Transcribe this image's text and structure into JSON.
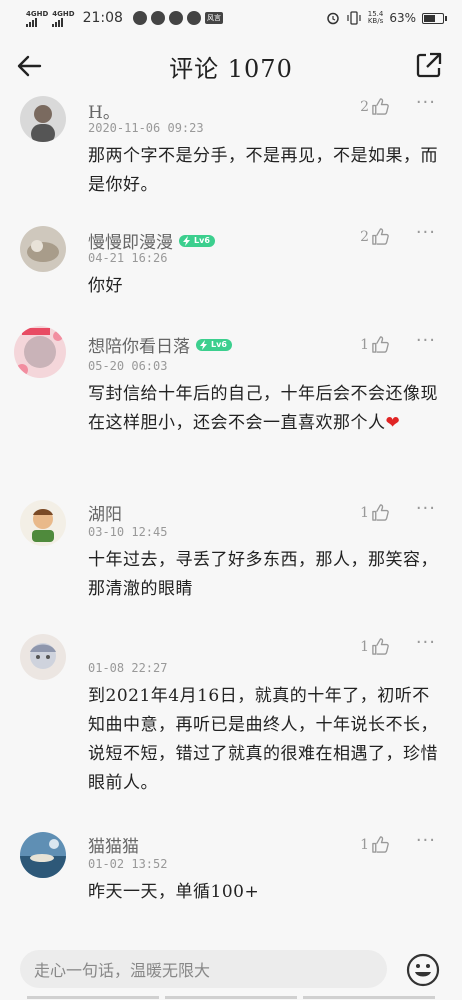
{
  "status_bar": {
    "network1": "4GHD",
    "network2": "4GHD",
    "time": "21:08",
    "app_tag": "风言",
    "speed_value": "15.4",
    "speed_unit": "KB/s",
    "battery_percent": "63%",
    "battery_level": 0.63
  },
  "header": {
    "title": "评论 1070",
    "back_icon": "arrow-left-icon",
    "share_icon": "share-icon"
  },
  "comments": [
    {
      "user": "H。",
      "level": "",
      "time": "2020-11-06 09:23",
      "likes": "2",
      "text": "那两个字不是分手，不是再见，不是如果，而是你好。"
    },
    {
      "user": "慢慢即漫漫",
      "level": "Lv6",
      "time": "04-21 16:26",
      "likes": "2",
      "text": "你好"
    },
    {
      "user": "想陪你看日落",
      "level": "Lv6",
      "time": "05-20 06:03",
      "likes": "1",
      "text": "写封信给十年后的自己，十年后会不会还像现在这样胆小，还会不会一直喜欢那个人❤️"
    },
    {
      "user": "湖阳",
      "level": "",
      "time": "03-10 12:45",
      "likes": "1",
      "text": "十年过去，寻丢了好多东西，那人，那笑容，那清澈的眼睛"
    },
    {
      "user": "",
      "level": "",
      "time": "01-08 22:27",
      "likes": "1",
      "text": "到2021年4月16日，就真的十年了，初听不知曲中意，再听已是曲终人，十年说长不长，说短不短，错过了就真的很难在相遇了，珍惜眼前人。"
    },
    {
      "user": "猫猫猫",
      "level": "",
      "time": "01-02 13:52",
      "likes": "1",
      "text": "昨天一天，单循100+"
    }
  ],
  "more_label": "···",
  "input": {
    "placeholder": "走心一句话，温暖无限大"
  },
  "icons": {
    "like": "thumbs-up-icon",
    "more": "more-dots-icon",
    "emoji": "emoji-smile-icon"
  },
  "colors": {
    "level_badge": "#3ccf8e",
    "heart": "#e02424"
  }
}
